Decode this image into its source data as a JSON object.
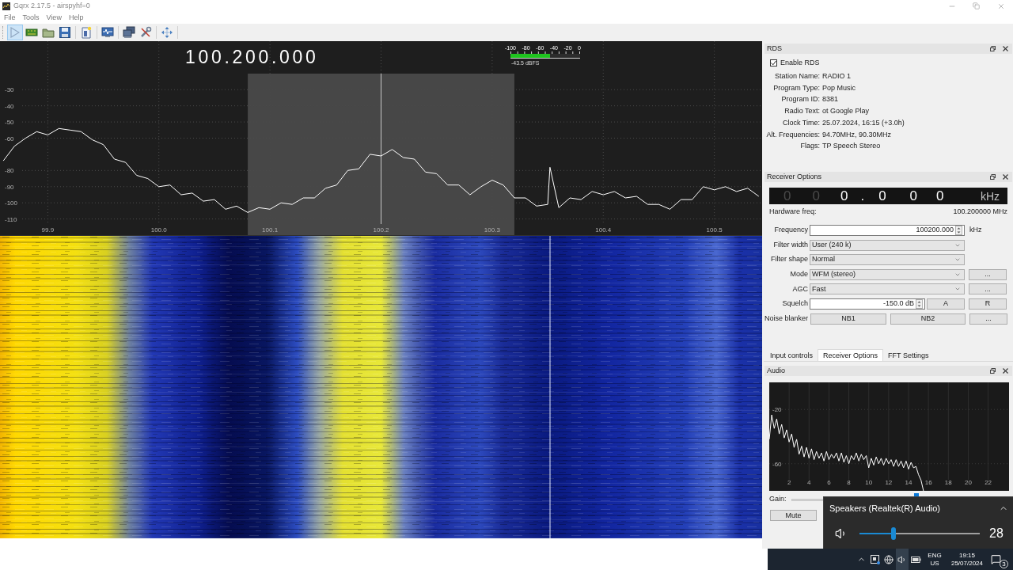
{
  "window": {
    "title": "Gqrx 2.17.5 - airspyhf=0"
  },
  "menu": [
    "File",
    "Tools",
    "View",
    "Help"
  ],
  "toolbar": {
    "play_pressed": true
  },
  "spectrum": {
    "frequency": "100.200.000",
    "meter": {
      "scale": [
        "-100",
        "-80",
        "-60",
        "-40",
        "-20",
        "0"
      ],
      "level": 0.565,
      "reading": "-43.5 dBFS"
    },
    "chart_data": [
      {
        "type": "line",
        "xlim": [
          99.857,
          100.543
        ],
        "ylim": [
          -120,
          0
        ],
        "xticks": [
          {
            "value": 99.9,
            "label": "99.9"
          },
          {
            "value": 100,
            "label": "100.0"
          },
          {
            "value": 100.1,
            "label": "100.1"
          },
          {
            "value": 100.2,
            "label": "100.2"
          },
          {
            "value": 100.3,
            "label": "100.3"
          },
          {
            "value": 100.4,
            "label": "100.4"
          },
          {
            "value": 100.5,
            "label": "100.5"
          }
        ],
        "yticks": [
          -30,
          -40,
          -50,
          -60,
          -80,
          -90,
          -100,
          -110
        ],
        "grid": true,
        "color": "#ffffff",
        "bands": [
          {
            "axis": "x",
            "from": 100.08,
            "to": 100.32,
            "color": "#474747"
          }
        ],
        "ref_lines": [
          {
            "axis": "x",
            "value": 100.2,
            "color": "#c8c8c8"
          }
        ],
        "x": [
          99.86,
          99.87,
          99.88,
          99.89,
          99.9,
          99.91,
          99.92,
          99.93,
          99.94,
          99.95,
          99.96,
          99.97,
          99.98,
          99.99,
          100,
          100.01,
          100.02,
          100.03,
          100.04,
          100.05,
          100.06,
          100.07,
          100.08,
          100.09,
          100.1,
          100.11,
          100.12,
          100.13,
          100.14,
          100.15,
          100.16,
          100.17,
          100.18,
          100.19,
          100.2,
          100.21,
          100.22,
          100.23,
          100.24,
          100.25,
          100.26,
          100.27,
          100.28,
          100.29,
          100.3,
          100.31,
          100.32,
          100.33,
          100.34,
          100.35,
          100.352,
          100.36,
          100.37,
          100.38,
          100.39,
          100.4,
          100.41,
          100.42,
          100.43,
          100.44,
          100.45,
          100.46,
          100.47,
          100.48,
          100.49,
          100.5,
          100.51,
          100.52,
          100.53,
          100.54
        ],
        "values": [
          -74,
          -65,
          -60,
          -56,
          -58,
          -54,
          -55,
          -56,
          -61,
          -64,
          -73,
          -75,
          -83,
          -85,
          -90,
          -89,
          -95,
          -94,
          -99,
          -98,
          -104,
          -102,
          -106,
          -103,
          -104,
          -100,
          -101,
          -97,
          -97,
          -91,
          -89,
          -80,
          -79,
          -70,
          -71,
          -67,
          -72,
          -73,
          -81,
          -82,
          -89,
          -89,
          -95,
          -90,
          -86,
          -89,
          -97,
          -97,
          -102,
          -101,
          -78,
          -103,
          -97,
          -98,
          -93,
          -95,
          -93,
          -97,
          -96,
          -101,
          -101,
          -104,
          -98,
          -98,
          -90,
          -92,
          -90,
          -93,
          -91,
          -96
        ]
      }
    ]
  },
  "rds": {
    "title": "RDS",
    "enable": {
      "label": "Enable RDS",
      "checked": true
    },
    "fields": [
      {
        "label": "Station Name:",
        "value": "RADIO 1"
      },
      {
        "label": "Program Type:",
        "value": "Pop Music"
      },
      {
        "label": "Program ID:",
        "value": "8381"
      },
      {
        "label": "Radio Text:",
        "value": "ot Google Play"
      },
      {
        "label": "Clock Time:",
        "value": "25.07.2024, 16:15 (+3.0h)"
      },
      {
        "label": "Alt. Frequencies:",
        "value": "94.70MHz, 90.30MHz"
      },
      {
        "label": "Flags:",
        "value": "TP Speech Stereo"
      }
    ]
  },
  "receiver_options": {
    "title": "Receiver Options",
    "offset_display": {
      "digits": [
        {
          "text": "0",
          "dim": true
        },
        {
          "text": "0",
          "dim": true
        },
        {
          "text": "0",
          "dim": false
        },
        {
          "text": ".",
          "dim": false
        },
        {
          "text": "0",
          "dim": false
        },
        {
          "text": "0",
          "dim": false
        },
        {
          "text": "0",
          "dim": false
        }
      ],
      "unit": "kHz"
    },
    "hardware_freq": {
      "label": "Hardware freq:",
      "value": "100.200000 MHz"
    },
    "rows": [
      {
        "label": "Frequency",
        "kind": "spinbox",
        "value": "100200.000",
        "unit": "kHz"
      },
      {
        "label": "Filter width",
        "kind": "combo",
        "value": "User (240 k)"
      },
      {
        "label": "Filter shape",
        "kind": "combo",
        "value": "Normal"
      },
      {
        "label": "Mode",
        "kind": "combo",
        "value": "WFM (stereo)",
        "buttons": [
          "..."
        ]
      },
      {
        "label": "AGC",
        "kind": "combo",
        "value": "Fast",
        "buttons": [
          "..."
        ]
      },
      {
        "label": "Squelch",
        "kind": "spinbox",
        "value": "-150.0 dB",
        "buttons": [
          "A",
          "R"
        ]
      },
      {
        "label": "Noise blanker",
        "kind": "buttons",
        "buttons": [
          "NB1",
          "NB2",
          "..."
        ]
      }
    ]
  },
  "dock_tabs": [
    {
      "label": "Input controls",
      "selected": false
    },
    {
      "label": "Receiver Options",
      "selected": true
    },
    {
      "label": "FFT Settings",
      "selected": false
    }
  ],
  "audio": {
    "title": "Audio",
    "chart_data": [
      {
        "type": "line",
        "xlim": [
          0,
          24.1
        ],
        "ylim": [
          -80,
          0
        ],
        "xticks": [
          2,
          4,
          6,
          8,
          10,
          12,
          14,
          16,
          18,
          20,
          22
        ],
        "yticks": [
          -20,
          -60
        ],
        "grid": true,
        "color": "#ffffff",
        "x": [
          0,
          0.25,
          0.5,
          0.75,
          1,
          1.25,
          1.5,
          1.75,
          2,
          2.25,
          2.5,
          2.75,
          3,
          3.25,
          3.5,
          3.75,
          4,
          4.25,
          4.5,
          4.75,
          5,
          5.25,
          5.5,
          5.75,
          6,
          6.25,
          6.5,
          6.75,
          7,
          7.25,
          7.5,
          7.75,
          8,
          8.25,
          8.5,
          8.75,
          9,
          9.25,
          9.5,
          9.75,
          10,
          10.25,
          10.5,
          10.75,
          11,
          11.25,
          11.5,
          11.75,
          12,
          12.25,
          12.5,
          12.75,
          13,
          13.25,
          13.5,
          13.75,
          14,
          14.25,
          14.5,
          14.75,
          15,
          15.25,
          15.5
        ],
        "values": [
          -42,
          -24,
          -34,
          -27,
          -38,
          -31,
          -41,
          -35,
          -44,
          -38,
          -48,
          -42,
          -53,
          -47,
          -55,
          -48,
          -56,
          -49,
          -57,
          -51,
          -56,
          -52,
          -58,
          -51,
          -57,
          -53,
          -56,
          -52,
          -58,
          -52,
          -59,
          -54,
          -60,
          -54,
          -57,
          -52,
          -58,
          -53,
          -57,
          -54,
          -63,
          -56,
          -61,
          -55,
          -60,
          -56,
          -61,
          -56,
          -60,
          -57,
          -62,
          -57,
          -62,
          -58,
          -63,
          -58,
          -64,
          -59,
          -63,
          -62,
          -68,
          -72,
          -80
        ]
      }
    ],
    "gain": {
      "label": "Gain:",
      "level": 0.57
    },
    "buttons": [
      "Mute"
    ]
  },
  "volume_popup": {
    "device": "Speakers (Realtek(R) Audio)",
    "level": 0.28,
    "reading": "28"
  },
  "taskbar": {
    "volume_selected": true,
    "language": "ENG",
    "region": "US",
    "time": "19:15",
    "date": "25/07/2024",
    "notifications": "3"
  }
}
